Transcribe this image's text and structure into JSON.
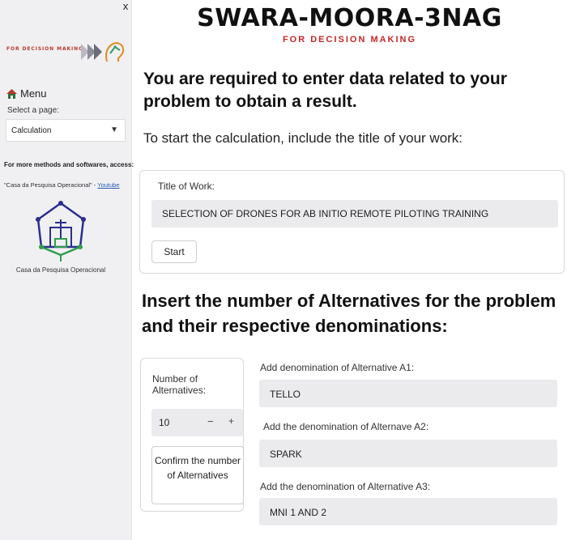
{
  "sidebar": {
    "close": "x",
    "logo_text": "FOR DECISION MAKING",
    "menu": "Menu",
    "select_label": "Select a page:",
    "select_value": "Calculation",
    "more_label": "For more methods and softwares, access:",
    "casa_text": "\"Casa da Pesquisa Operacional\" -",
    "youtube": "Youtube",
    "house_caption": "Casa da Pesquisa Operacional"
  },
  "header": {
    "title": "SWARA-MOORA-3NAG",
    "subtitle": "FOR DECISION MAKING"
  },
  "main": {
    "required_heading": "You are required to enter data related to your problem to obtain a result.",
    "start_text": "To start the calculation, include the title of your work:",
    "title_label": "Title of Work:",
    "title_value": "SELECTION OF DRONES FOR AB INITIO REMOTE PILOTING TRAINING",
    "start_button": "Start",
    "insert_heading": "Insert the number of Alternatives for the problem and their respective denominations:",
    "number_label": "Number of Alternatives:",
    "number_value": "10",
    "minus": "−",
    "plus": "+",
    "confirm_button": "Confirm the number of Alternatives",
    "alternatives": [
      {
        "label": "Add denomination of Alternative A1:",
        "value": "TELLO"
      },
      {
        "label": "Add the denomination of Alternave A2:",
        "value": "SPARK"
      },
      {
        "label": "Add the denomination of Alternative A3:",
        "value": "MNI 1 AND 2"
      }
    ]
  },
  "colors": {
    "accent_red": "#c62828",
    "sidebar_bg": "#f0f0f2",
    "input_bg": "#ebebed"
  }
}
